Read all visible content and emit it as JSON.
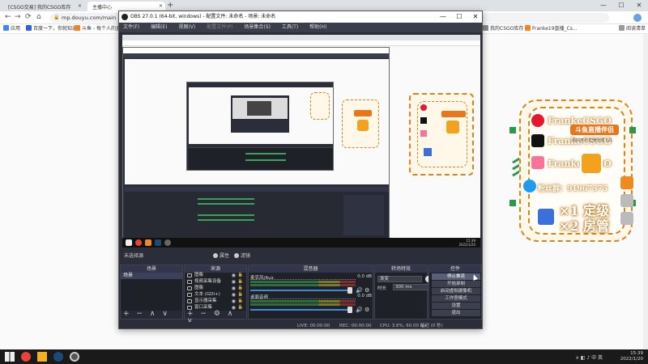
{
  "browser": {
    "tabs": [
      {
        "label": "[CSGO交易] 我的CSGO库存"
      },
      {
        "label": "主播中心"
      }
    ],
    "new_tab": "+",
    "window_controls": {
      "minimize": "—",
      "maximize": "☐",
      "close": "✕"
    },
    "nav": {
      "back": "←",
      "forward": "→",
      "reload": "⟳",
      "home": "⌂"
    },
    "url": "mp.douyu.com/main",
    "bookmarks": [
      {
        "label": "应用",
        "color": "#4285f4"
      },
      {
        "label": "百度一下，你就知道",
        "color": "#2c62e0"
      },
      {
        "label": "斗鱼 - 每个人的直播平台",
        "color": "#f58220"
      },
      {
        "label": "我的CSGO库存",
        "color": "#888888"
      },
      {
        "label": "Franke19直播_Cs...",
        "color": "#f58220"
      }
    ],
    "reading_list": "阅读清单"
  },
  "live_panel": {
    "rows": [
      {
        "text": "FrankeCSGO",
        "icon": "weibo-icon",
        "color": "#e6162d"
      },
      {
        "text": "FrankeCSGO",
        "icon": "tiktok-icon",
        "color": "#111111"
      },
      {
        "text": "FrankeCSGO",
        "icon": "bilibili-icon",
        "color": "#fb7299"
      },
      {
        "text": "粉丝群：91967375",
        "icon": "qq-icon",
        "color": "#1d9bf0"
      }
    ],
    "banner": "斗鱼直播伴侣",
    "subtitle": "超好用的直播管理工具",
    "line1": "×1 定级",
    "line2": "×2 房管"
  },
  "obs": {
    "title": "OBS 27.0.1 (64-bit, windows) - 配置文件: 未命名 - 场景: 未命名",
    "menu": [
      "文件(F)",
      "编辑(E)",
      "视图(V)",
      "配置文件(P)",
      "场景集合(S)",
      "工具(T)",
      "帮助(H)"
    ],
    "menu_dim": [
      false,
      false,
      false,
      true,
      false,
      false,
      false
    ],
    "window_controls": {
      "minimize": "—",
      "maximize": "☐",
      "close": "✕"
    },
    "no_source": "未选择源",
    "properties": "属性",
    "filters": "滤镜",
    "docks": {
      "scenes": {
        "title": "场景",
        "items": [
          "场景"
        ]
      },
      "sources": {
        "title": "来源",
        "items": [
          "图像",
          "视频采集设备",
          "图像",
          "文本 (GDI+)",
          "显示器采集",
          "窗口采集"
        ]
      },
      "mixer": {
        "title": "混音器",
        "channels": [
          {
            "name": "麦克风/Aux",
            "db": "0.0 dB"
          },
          {
            "name": "桌面音频",
            "db": "0.0 dB"
          }
        ]
      },
      "transitions": {
        "title": "转场特效",
        "selected": "渐变",
        "duration_label": "时长",
        "duration": "300 ms"
      },
      "controls": {
        "title": "控件",
        "buttons": [
          "停止推流",
          "开始录制",
          "启动虚拟摄像机",
          "工作室模式",
          "设置",
          "退出"
        ]
      }
    },
    "dock_footer": {
      "add": "+",
      "remove": "−",
      "up": "∧",
      "down": "∨",
      "settings": "⚙"
    },
    "status": {
      "dropped": "丢帧 0 (0.0%)",
      "live": "LIVE: 00:00:00",
      "rec": "REC: 00:00:00",
      "cpu": "CPU: 3.6%, 60.00 fps",
      "kbps": "延迟 (0 秒)"
    }
  },
  "preview_clock": {
    "time": "15:39",
    "date": "2022/1/20"
  },
  "taskbar": {
    "time": "15:39",
    "date": "2022/1/20",
    "tray": "∧ ◧ ♪ 中 英"
  }
}
